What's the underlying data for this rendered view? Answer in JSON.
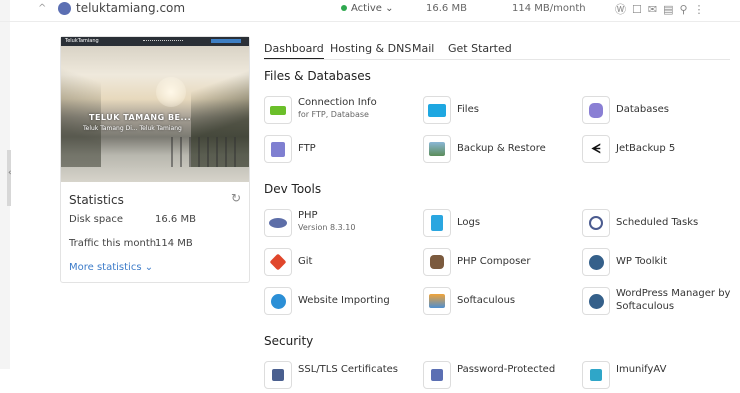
{
  "topbar": {
    "domain": "teluktamiang.com",
    "status": "Active",
    "disk": "16.6 MB",
    "bandwidth": "114 MB/month",
    "status_color": "#2fa84f"
  },
  "thumbnail": {
    "site_name": "TelukTamiang",
    "headline": "TELUK TAMANG BE...",
    "subtitle": "Teluk Tamang Di... Teluk Tamiang"
  },
  "stats": {
    "title": "Statistics",
    "rows": [
      {
        "label": "Disk space",
        "value": "16.6 MB"
      },
      {
        "label": "Traffic this month",
        "value": "114 MB"
      }
    ],
    "more": "More statistics"
  },
  "tabs": [
    "Dashboard",
    "Hosting & DNS",
    "Mail",
    "Get Started"
  ],
  "sections": {
    "files_db": {
      "title": "Files & Databases",
      "items": [
        {
          "label": "Connection Info",
          "sub": "for FTP, Database",
          "icon": "connection-plug-icon"
        },
        {
          "label": "Files",
          "icon": "folder-icon"
        },
        {
          "label": "Databases",
          "icon": "database-icon"
        },
        {
          "label": "FTP",
          "icon": "ftp-server-icon"
        },
        {
          "label": "Backup & Restore",
          "icon": "backup-icon"
        },
        {
          "label": "JetBackup 5",
          "icon": "jetbackup-icon"
        }
      ]
    },
    "dev_tools": {
      "title": "Dev Tools",
      "items": [
        {
          "label": "PHP",
          "sub": "Version 8.3.10",
          "icon": "php-icon"
        },
        {
          "label": "Logs",
          "icon": "logs-icon"
        },
        {
          "label": "Scheduled Tasks",
          "icon": "clock-icon"
        },
        {
          "label": "Git",
          "icon": "git-icon"
        },
        {
          "label": "PHP Composer",
          "icon": "composer-icon"
        },
        {
          "label": "WP Toolkit",
          "icon": "wordpress-icon"
        },
        {
          "label": "Website Importing",
          "icon": "import-icon"
        },
        {
          "label": "Softaculous",
          "icon": "softaculous-icon"
        },
        {
          "label": "WordPress Manager by Softaculous",
          "icon": "wordpress-icon"
        }
      ]
    },
    "security": {
      "title": "Security",
      "items": [
        {
          "label": "SSL/TLS Certificates",
          "icon": "lock-icon"
        },
        {
          "label": "Password-Protected",
          "icon": "password-icon"
        },
        {
          "label": "ImunifyAV",
          "icon": "shield-icon"
        }
      ]
    }
  }
}
